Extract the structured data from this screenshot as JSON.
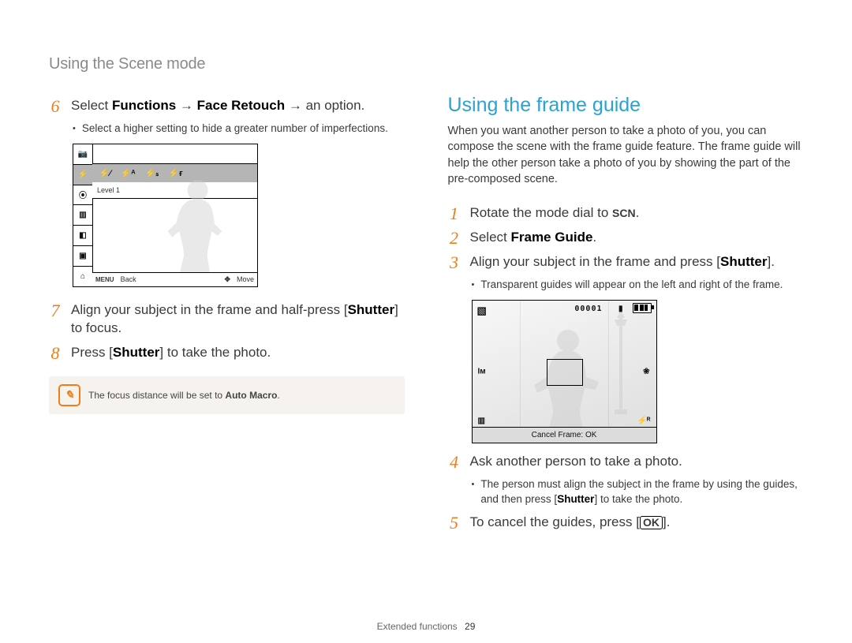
{
  "header": {
    "title": "Using the Scene mode"
  },
  "left": {
    "step6_pre": "Select ",
    "step6_b1": "Functions",
    "step6_mid1": " → ",
    "step6_b2": "Face Retouch",
    "step6_mid2": " → an option.",
    "step6_sub": "Select a higher setting to hide a greater number of imperfections.",
    "shot1_toolbar": {
      "i1": "⚡⁄",
      "i2": "⚡ᴬ",
      "i3": "⚡ₛ",
      "i4": "⚡ғ"
    },
    "shot1_level": "Level 1",
    "shot1_back_label": "Back",
    "shot1_menu_glyph": "MENU",
    "shot1_move_label": "Move",
    "step7_pre": "Align your subject in the frame and half-press [",
    "step7_b": "Shutter",
    "step7_post": "] to focus.",
    "step8_pre": "Press [",
    "step8_b": "Shutter",
    "step8_post": "] to take the photo.",
    "note_pre": "The focus distance will be set to ",
    "note_b": "Auto Macro",
    "note_post": "."
  },
  "right": {
    "h2": "Using the frame guide",
    "intro": "When you want another person to take a photo of you, you can compose the scene with the frame guide feature. The frame guide will help the other person take a photo of you by showing the part of the pre-composed scene.",
    "step1_pre": "Rotate the mode dial to ",
    "step1_scn": "SCN",
    "step1_post": ".",
    "step2_pre": "Select ",
    "step2_b": "Frame Guide",
    "step2_post": ".",
    "step3_pre": "Align your subject in the frame and press [",
    "step3_b": "Shutter",
    "step3_post": "].",
    "step3_sub": "Transparent guides will appear on the left and right of the frame.",
    "shot2_counter": "00001",
    "shot2_cancel": "Cancel Frame: OK",
    "step4_text": "Ask another person to take a photo.",
    "step4_sub_pre": "The person must align the subject in the frame by using the guides, and then press [",
    "step4_sub_b": "Shutter",
    "step4_sub_post": "] to take the photo.",
    "step5_pre": "To cancel the guides, press [",
    "step5_ok": "OK",
    "step5_post": "]."
  },
  "footer": {
    "section": "Extended functions",
    "page": "29"
  }
}
